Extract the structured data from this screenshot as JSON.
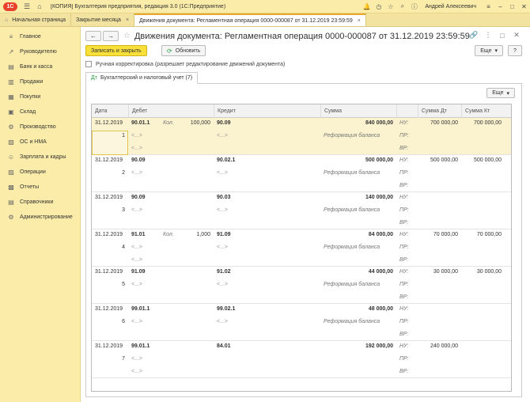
{
  "titlebar": {
    "logo": "1С",
    "title": "[КОПИЯ] Бухгалтерия предприятия, редакция 3.0  (1С:Предприятие)",
    "user": "Андрей Алексеевич",
    "icons": [
      "bell-icon",
      "history-icon",
      "star-icon",
      "search-icon",
      "info-icon"
    ]
  },
  "tabs": [
    {
      "label": "Начальная страница",
      "closable": false,
      "active": false
    },
    {
      "label": "Закрытие месяца",
      "closable": true,
      "active": false
    },
    {
      "label": "Движения документа: Регламентная операция 0000-000087 от 31.12.2019 23:59:59",
      "closable": true,
      "active": true
    }
  ],
  "sidebar": {
    "items": [
      {
        "label": "Главное",
        "icon": "menu-icon"
      },
      {
        "label": "Руководителю",
        "icon": "chart-icon"
      },
      {
        "label": "Банк и касса",
        "icon": "bank-icon"
      },
      {
        "label": "Продажи",
        "icon": "sales-icon"
      },
      {
        "label": "Покупки",
        "icon": "cart-icon"
      },
      {
        "label": "Склад",
        "icon": "warehouse-icon"
      },
      {
        "label": "Производство",
        "icon": "factory-icon"
      },
      {
        "label": "ОС и НМА",
        "icon": "assets-icon"
      },
      {
        "label": "Зарплата и кадры",
        "icon": "people-icon"
      },
      {
        "label": "Операции",
        "icon": "operations-icon"
      },
      {
        "label": "Отчеты",
        "icon": "reports-icon"
      },
      {
        "label": "Справочники",
        "icon": "book-icon"
      },
      {
        "label": "Администрирование",
        "icon": "gear-icon"
      }
    ]
  },
  "document": {
    "title": "Движения документа: Регламентная операция 0000-000087 от 31.12.2019 23:59:59",
    "save_close": "Записать и закрыть",
    "refresh": "Обновить",
    "more": "Еще",
    "help": "?",
    "manual_label": "Ручная корректировка (разрешает редактирование движений документа)",
    "subtab_label": "Бухгалтерский и налоговый учет (7)",
    "more2": "Еще"
  },
  "grid": {
    "headers": [
      "Дата",
      "Дебет",
      "Кредит",
      "Сумма",
      "Сумма Дт",
      "Сумма Кт"
    ],
    "row_types": [
      "НУ:",
      "ПР:",
      "ВР:"
    ],
    "rows": [
      {
        "date": "31.12.2019",
        "num": "1",
        "debit": "90.01.1",
        "qty_label": "Кол.",
        "qty": "100,000",
        "credit": "90.09",
        "amount": "840 000,00",
        "sum_dt": "700 000,00",
        "sum_kt": "700 000,00",
        "d1": "<...>",
        "d2": "<...>",
        "c1": "<...>",
        "content": "Реформация баланса"
      },
      {
        "date": "31.12.2019",
        "num": "2",
        "debit": "90.09",
        "qty_label": "",
        "qty": "",
        "credit": "90.02.1",
        "amount": "500 000,00",
        "sum_dt": "500 000,00",
        "sum_kt": "500 000,00",
        "d1": "<...>",
        "d2": "",
        "c1": "<...>",
        "content": "Реформация баланса"
      },
      {
        "date": "31.12.2019",
        "num": "3",
        "debit": "90.09",
        "qty_label": "",
        "qty": "",
        "credit": "90.03",
        "amount": "140 000,00",
        "sum_dt": "",
        "sum_kt": "",
        "d1": "<...>",
        "d2": "",
        "c1": "<...>",
        "content": "Реформация баланса"
      },
      {
        "date": "31.12.2019",
        "num": "4",
        "debit": "91.01",
        "qty_label": "Кол.",
        "qty": "1,000",
        "credit": "91.09",
        "amount": "84 000,00",
        "sum_dt": "70 000,00",
        "sum_kt": "70 000,00",
        "d1": "<...>",
        "d2": "<...>",
        "c1": "<...>",
        "content": "Реформация баланса"
      },
      {
        "date": "31.12.2019",
        "num": "5",
        "debit": "91.09",
        "qty_label": "",
        "qty": "",
        "credit": "91.02",
        "amount": "44 000,00",
        "sum_dt": "30 000,00",
        "sum_kt": "30 000,00",
        "d1": "<...>",
        "d2": "",
        "c1": "<...>",
        "content": "Реформация баланса"
      },
      {
        "date": "31.12.2019",
        "num": "6",
        "debit": "99.01.1",
        "qty_label": "",
        "qty": "",
        "credit": "99.02.1",
        "amount": "48 000,00",
        "sum_dt": "",
        "sum_kt": "",
        "d1": "<...>",
        "d2": "",
        "c1": "<...>",
        "content": "Реформация баланса"
      },
      {
        "date": "31.12.2019",
        "num": "7",
        "debit": "99.01.1",
        "qty_label": "",
        "qty": "",
        "credit": "84.01",
        "amount": "192 000,00",
        "sum_dt": "240 000,00",
        "sum_kt": "",
        "d1": "<...>",
        "d2": "<...>",
        "c1": "",
        "content": ""
      }
    ]
  },
  "colors": {
    "accent": "#f8df3a",
    "sidebar": "#fbeda9",
    "selection": "#fbf3cf"
  }
}
